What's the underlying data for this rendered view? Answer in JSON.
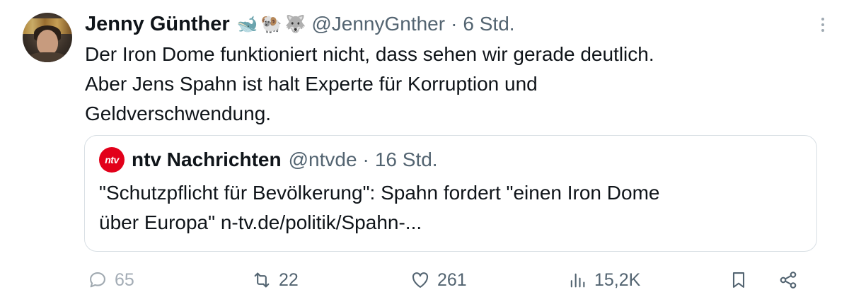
{
  "author": {
    "display_name": "Jenny Günther",
    "badges": [
      {
        "icon": "whale-emoji",
        "glyph": "🐋"
      },
      {
        "icon": "ram-emoji",
        "glyph": "🐏"
      },
      {
        "icon": "wolf-emoji",
        "glyph": "🐺"
      }
    ],
    "handle": "@JennyGnther",
    "separator": "·",
    "time": "6 Std."
  },
  "text_lines": [
    "Der Iron Dome funktioniert nicht, dass sehen wir gerade deutlich.",
    "Aber Jens Spahn ist halt Experte für Korruption und",
    "Geldverschwendung."
  ],
  "quote": {
    "logo_text": "ntv",
    "name": "ntv Nachrichten",
    "handle": "@ntvde",
    "separator": "·",
    "time": "16 Std.",
    "text_lines": [
      "\"Schutzpflicht für Bevölkerung\": Spahn fordert \"einen Iron Dome",
      "über Europa\" n-tv.de/politik/Spahn-..."
    ]
  },
  "actions": {
    "replies": "65",
    "reposts": "22",
    "likes": "261",
    "views": "15,2K"
  },
  "colors": {
    "text": "#0f1419",
    "secondary": "#536471",
    "border": "#d8dfe4",
    "ntv_red": "#e2001a"
  }
}
